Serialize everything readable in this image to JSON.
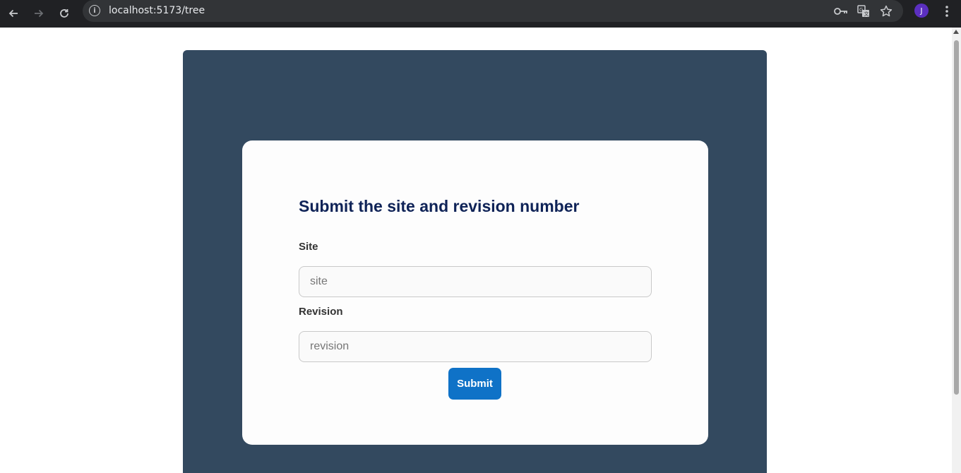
{
  "browser": {
    "url": "localhost:5173/tree",
    "back_icon": "back-arrow-icon",
    "forward_icon": "forward-arrow-icon",
    "reload_icon": "reload-icon",
    "avatar_letter": "J",
    "avatar_color": "#5b2fc0"
  },
  "form": {
    "title": "Submit the site and revision number",
    "site_label": "Site",
    "site_placeholder": "site",
    "site_value": "",
    "revision_label": "Revision",
    "revision_placeholder": "revision",
    "revision_value": "",
    "submit_label": "Submit"
  },
  "colors": {
    "panel_background": "#33495f",
    "card_background": "#fdfdfd",
    "title_color": "#0f2357",
    "button_color": "#0f72c7"
  }
}
